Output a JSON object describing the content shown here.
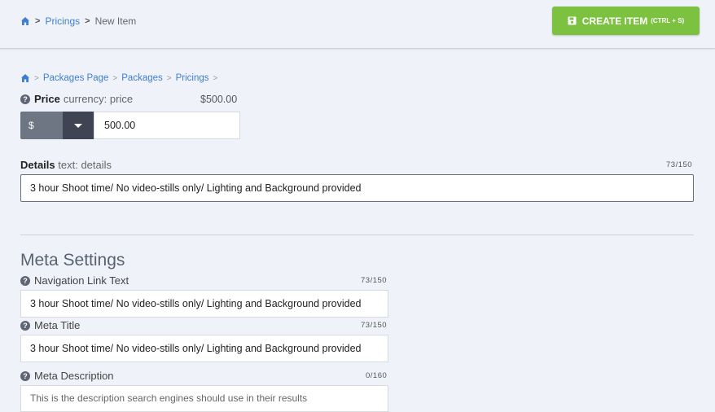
{
  "header": {
    "breadcrumb": {
      "home_icon": "home-icon",
      "items": [
        "Pricings"
      ],
      "current": "New Item"
    },
    "create_button": {
      "label": "CREATE ITEM",
      "shortcut": "(CTRL + S)",
      "icon": "save-icon",
      "color": "#7cc240"
    }
  },
  "content_breadcrumb": {
    "home_icon": "home-icon",
    "items": [
      "Packages Page",
      "Packages",
      "Pricings"
    ]
  },
  "price": {
    "label": "Price",
    "type_hint": "currency: price",
    "preview": "$500.00",
    "currency_symbol": "$",
    "value": "500.00"
  },
  "details": {
    "label": "Details",
    "type_hint": "text: details",
    "counter": "73/150",
    "value": "3 hour Shoot time/ No video-stills only/ Lighting and Background provided"
  },
  "meta": {
    "heading": "Meta Settings",
    "nav_link": {
      "label": "Navigation Link Text",
      "counter": "73/150",
      "value": "3 hour Shoot time/ No video-stills only/ Lighting and Background provided"
    },
    "meta_title": {
      "label": "Meta Title",
      "counter": "73/150",
      "value": "3 hour Shoot time/ No video-stills only/ Lighting and Background provided"
    },
    "meta_description": {
      "label": "Meta Description",
      "counter": "0/160",
      "placeholder": "This is the description search engines should use in their results"
    }
  },
  "help_icon_glyph": "?",
  "colors": {
    "link": "#3d7fd0",
    "background": "#f0f2fa",
    "currency_select": "#6f7683",
    "currency_toggle": "#3f4453"
  }
}
